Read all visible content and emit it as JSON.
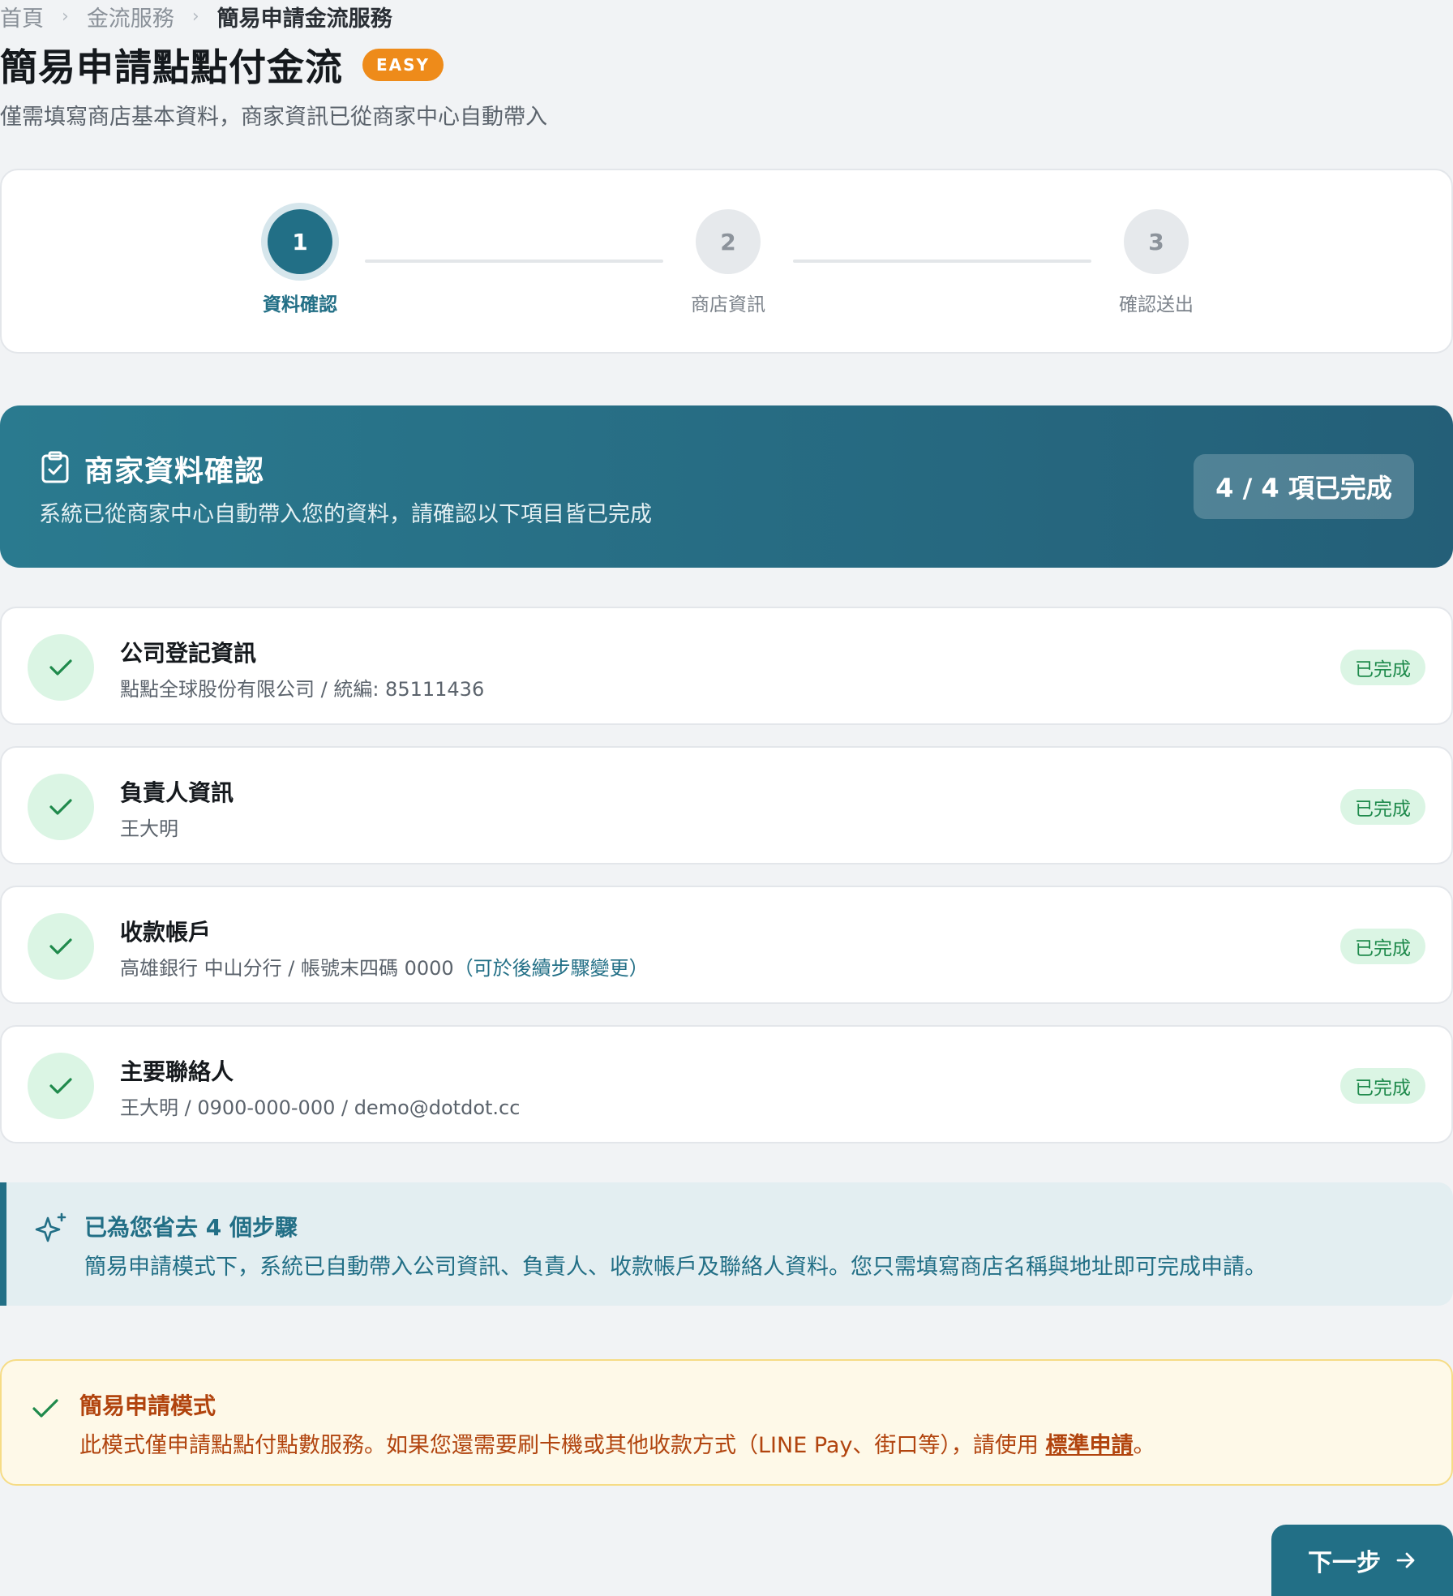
{
  "breadcrumb": {
    "items": [
      "首頁",
      "金流服務",
      "簡易申請金流服務"
    ],
    "separator": "›"
  },
  "header": {
    "title": "簡易申請點點付金流",
    "badge": "EASY",
    "subtitle": "僅需填寫商店基本資料，商家資訊已從商家中心自動帶入"
  },
  "stepper": {
    "current_step": 1,
    "steps": [
      {
        "number": "1",
        "label": "資料確認"
      },
      {
        "number": "2",
        "label": "商店資訊"
      },
      {
        "number": "3",
        "label": "確認送出"
      }
    ]
  },
  "banner": {
    "icon": "clipboard-check-icon",
    "title": "商家資料確認",
    "description": "系統已從商家中心自動帶入您的資料，請確認以下項目皆已完成",
    "progress": "4 / 4 項已完成"
  },
  "items": [
    {
      "title": "公司登記資訊",
      "detail": "點點全球股份有限公司 / 統編: 85111436",
      "note": "",
      "status": "已完成"
    },
    {
      "title": "負責人資訊",
      "detail": "王大明",
      "note": "",
      "status": "已完成"
    },
    {
      "title": "收款帳戶",
      "detail": "高雄銀行 中山分行 / 帳號末四碼 0000",
      "note": "（可於後續步驟變更）",
      "status": "已完成"
    },
    {
      "title": "主要聯絡人",
      "detail": "王大明 / 0900-000-000 / demo@dotdot.cc",
      "note": "",
      "status": "已完成"
    }
  ],
  "info": {
    "icon": "sparkle-icon",
    "title": "已為您省去 4 個步驟",
    "description": "簡易申請模式下，系統已自動帶入公司資訊、負責人、收款帳戶及聯絡人資料。您只需填寫商店名稱與地址即可完成申請。"
  },
  "warning": {
    "icon": "check-icon",
    "title": "簡易申請模式",
    "description_prefix": "此模式僅申請點點付點數服務。如果您還需要刷卡機或其他收款方式（LINE Pay、街口等），請使用",
    "link_label": "標準申請",
    "description_suffix": "。"
  },
  "actions": {
    "next_label": "下一步"
  },
  "colors": {
    "primary": "#226f86",
    "easy_badge": "#ee8b1a",
    "success_bg": "#dbf5e4",
    "success_text": "#1f8a4c",
    "warning_text": "#b1440e",
    "warning_bg": "#fef9e8",
    "page_bg": "#f1f3f5"
  }
}
